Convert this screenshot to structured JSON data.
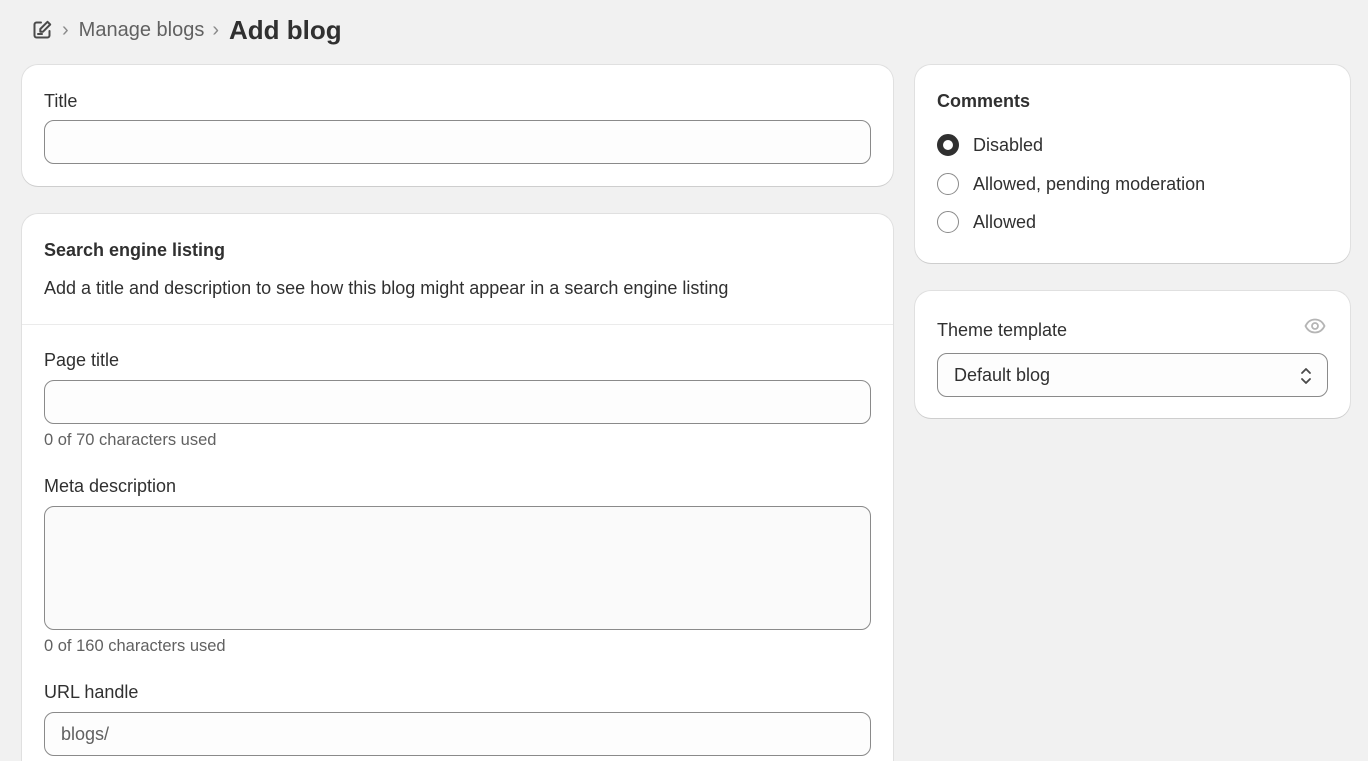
{
  "breadcrumb": {
    "icon": "edit-document-icon",
    "parent": "Manage blogs",
    "current": "Add blog",
    "separator": "›"
  },
  "title_card": {
    "label": "Title",
    "value": "",
    "placeholder": ""
  },
  "seo": {
    "heading": "Search engine listing",
    "description": "Add a title and description to see how this blog might appear in a search engine listing",
    "page_title": {
      "label": "Page title",
      "value": "",
      "hint": "0 of 70 characters used"
    },
    "meta_description": {
      "label": "Meta description",
      "value": "",
      "hint": "0 of 160 characters used"
    },
    "url_handle": {
      "label": "URL handle",
      "prefix": "blogs/",
      "value": ""
    }
  },
  "comments": {
    "heading": "Comments",
    "options": [
      {
        "label": "Disabled",
        "checked": true
      },
      {
        "label": "Allowed, pending moderation",
        "checked": false
      },
      {
        "label": "Allowed",
        "checked": false
      }
    ]
  },
  "theme": {
    "label": "Theme template",
    "selected": "Default blog",
    "icon": "eye-icon"
  },
  "colors": {
    "background": "#f1f1f1",
    "card": "#ffffff",
    "text": "#303030",
    "muted": "#616161",
    "border": "#8a8a8a"
  }
}
